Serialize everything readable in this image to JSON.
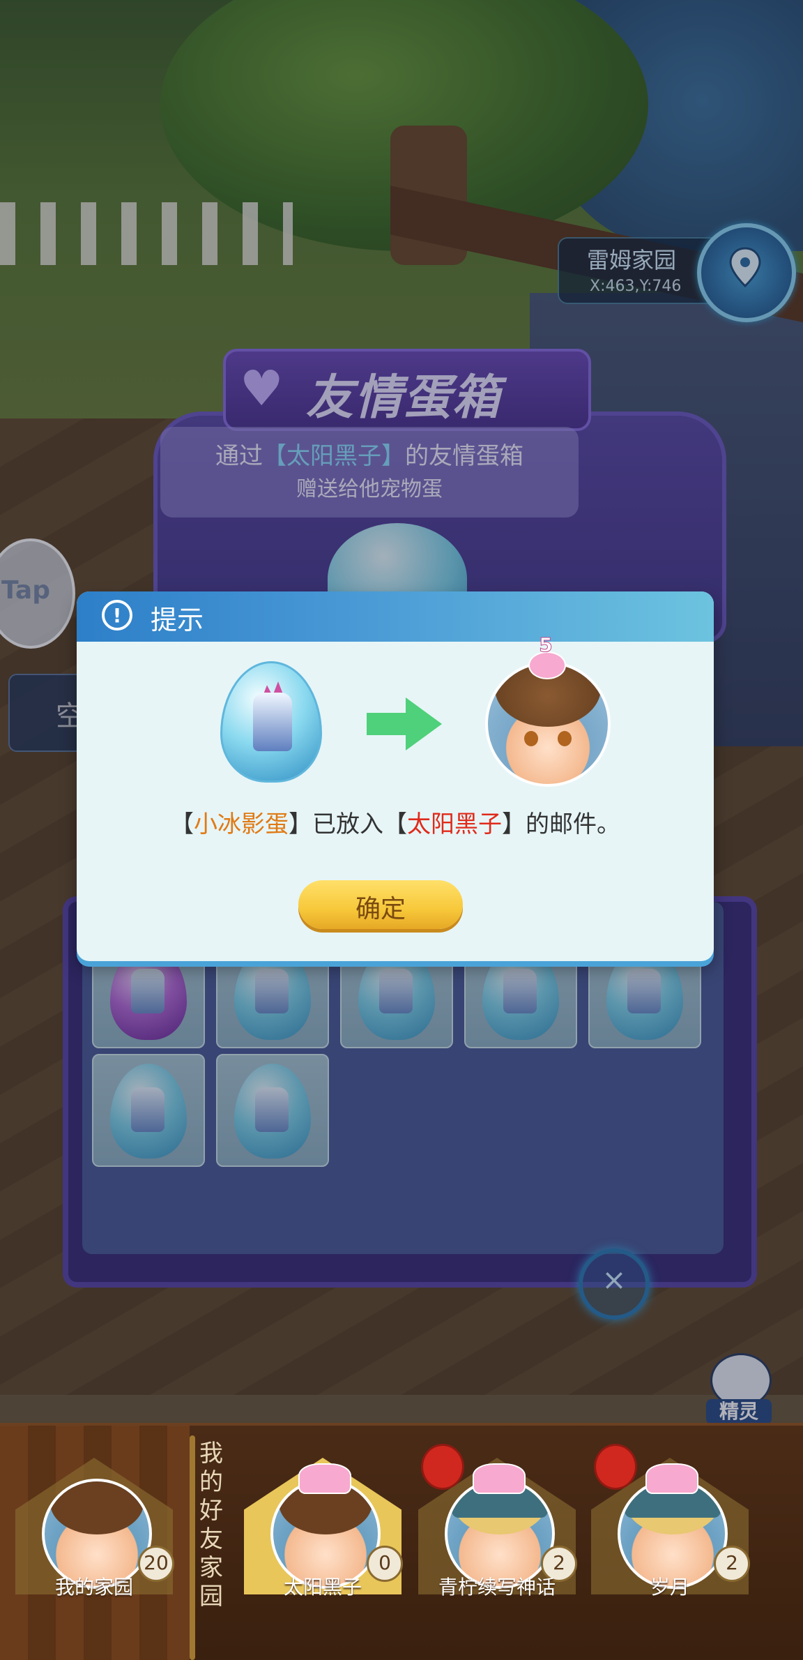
{
  "location": {
    "name": "雷姆家园",
    "coords": "X:463,Y:746"
  },
  "tap_label": "Tap",
  "left_tab_label": "空",
  "egg_box": {
    "title": "友情蛋箱",
    "desc_prefix": "通过",
    "friend_name": "【太阳黑子】",
    "desc_suffix": "的友情蛋箱",
    "desc_line2": "赠送给他宠物蛋",
    "slots": [
      "purple-egg",
      "ice-egg",
      "ice-egg",
      "ice-egg",
      "ice-egg",
      "ice-egg",
      "ice-egg"
    ]
  },
  "dialog": {
    "title": "提示",
    "alert_icon": "!",
    "message_open1": "【",
    "egg_name": "小冰影蛋",
    "message_mid1": "】已放入【",
    "recipient": "太阳黑子",
    "message_end": "】的邮件。",
    "confirm_label": "确定",
    "friend_level": "5"
  },
  "close_symbol": "×",
  "spirit_label": "精灵",
  "friends_section_label": "我的好友家园",
  "friend_bar": [
    {
      "name": "我的家园",
      "count": "20",
      "style": "brown"
    },
    {
      "name": "太阳黑子",
      "count": "0",
      "style": "brown",
      "active": true
    },
    {
      "name": "青柠续写神话",
      "count": "2",
      "style": "blonde"
    },
    {
      "name": "岁月",
      "count": "2",
      "style": "blonde"
    }
  ],
  "colors": {
    "dialog_header": "#2d7fc8",
    "confirm_button": "#f7c83a",
    "highlight_orange": "#e07a14",
    "highlight_red": "#e02a1a",
    "arrow_green": "#4fd07a"
  }
}
